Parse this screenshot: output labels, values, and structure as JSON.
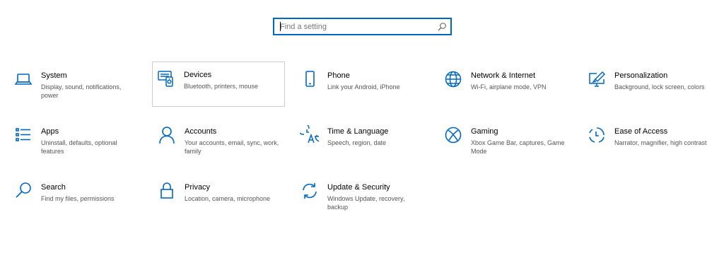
{
  "search": {
    "placeholder": "Find a setting",
    "value": ""
  },
  "accent_color": "#0067c0",
  "tiles": [
    {
      "title": "System",
      "description": "Display, sound, notifications, power",
      "icon": "laptop-icon"
    },
    {
      "title": "Devices",
      "description": "Bluetooth, printers, mouse",
      "icon": "devices-icon"
    },
    {
      "title": "Phone",
      "description": "Link your Android, iPhone",
      "icon": "phone-icon"
    },
    {
      "title": "Network & Internet",
      "description": "Wi-Fi, airplane mode, VPN",
      "icon": "globe-icon"
    },
    {
      "title": "Personalization",
      "description": "Background, lock screen, colors",
      "icon": "paintbrush-screen-icon"
    },
    {
      "title": "Apps",
      "description": "Uninstall, defaults, optional features",
      "icon": "apps-list-icon"
    },
    {
      "title": "Accounts",
      "description": "Your accounts, email, sync, work, family",
      "icon": "person-icon"
    },
    {
      "title": "Time & Language",
      "description": "Speech, region, date",
      "icon": "time-language-icon"
    },
    {
      "title": "Gaming",
      "description": "Xbox Game Bar, captures, Game Mode",
      "icon": "xbox-icon"
    },
    {
      "title": "Ease of Access",
      "description": "Narrator, magnifier, high contrast",
      "icon": "ease-of-access-icon"
    },
    {
      "title": "Search",
      "description": "Find my files, permissions",
      "icon": "magnifier-icon"
    },
    {
      "title": "Privacy",
      "description": "Location, camera, microphone",
      "icon": "lock-icon"
    },
    {
      "title": "Update & Security",
      "description": "Windows Update, recovery, backup",
      "icon": "sync-arrows-icon"
    }
  ]
}
